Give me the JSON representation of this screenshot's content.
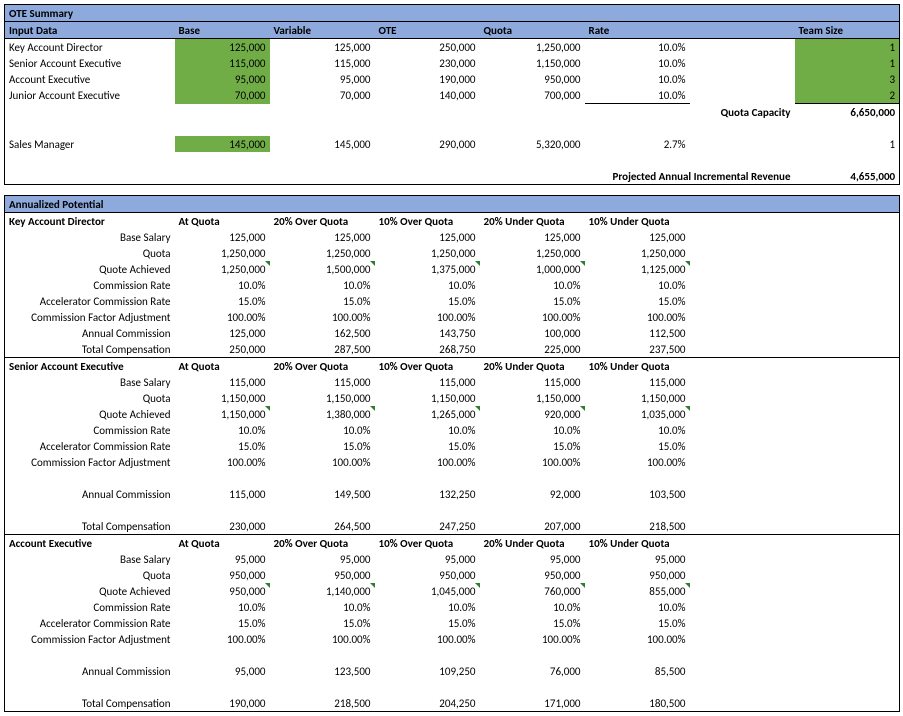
{
  "ote": {
    "title": "OTE Summary",
    "headers": {
      "input_data": "Input Data",
      "base": "Base",
      "variable": "Variable",
      "ote": "OTE",
      "quota": "Quota",
      "rate": "Rate",
      "team_size": "Team Size"
    },
    "rows": [
      {
        "role": "Key Account Director",
        "base": "125,000",
        "variable": "125,000",
        "ote": "250,000",
        "quota": "1,250,000",
        "rate": "10.0%",
        "team": "1"
      },
      {
        "role": "Senior Account Executive",
        "base": "115,000",
        "variable": "115,000",
        "ote": "230,000",
        "quota": "1,150,000",
        "rate": "10.0%",
        "team": "1"
      },
      {
        "role": "Account Executive",
        "base": "95,000",
        "variable": "95,000",
        "ote": "190,000",
        "quota": "950,000",
        "rate": "10.0%",
        "team": "3"
      },
      {
        "role": "Junior Account Executive",
        "base": "70,000",
        "variable": "70,000",
        "ote": "140,000",
        "quota": "700,000",
        "rate": "10.0%",
        "team": "2"
      }
    ],
    "quota_capacity_label": "Quota Capacity",
    "quota_capacity_value": "6,650,000",
    "manager": {
      "role": "Sales Manager",
      "base": "145,000",
      "variable": "145,000",
      "ote": "290,000",
      "quota": "5,320,000",
      "rate": "2.7%",
      "team": "1"
    },
    "projected_label": "Projected Annual Incremental Revenue",
    "projected_value": "4,655,000"
  },
  "annualized": {
    "title": "Annualized Potential",
    "scenario_labels": [
      "At Quota",
      "20% Over Quota",
      "10% Over Quota",
      "20% Under Quota",
      "10% Under Quota"
    ],
    "row_labels": {
      "base": "Base Salary",
      "quota": "Quota",
      "achieved": "Quote Achieved",
      "comm_rate": "Commission Rate",
      "accel_rate": "Accelerator Commission Rate",
      "factor": "Commission Factor Adjustment",
      "annual_comm": "Annual Commission",
      "total_comp": "Total Compensation"
    },
    "roles": [
      {
        "name": "Key Account Director",
        "base": [
          "125,000",
          "125,000",
          "125,000",
          "125,000",
          "125,000"
        ],
        "quota": [
          "1,250,000",
          "1,250,000",
          "1,250,000",
          "1,250,000",
          "1,250,000"
        ],
        "achieved": [
          "1,250,000",
          "1,500,000",
          "1,375,000",
          "1,000,000",
          "1,125,000"
        ],
        "comm_rate": [
          "10.0%",
          "10.0%",
          "10.0%",
          "10.0%",
          "10.0%"
        ],
        "accel_rate": [
          "15.0%",
          "15.0%",
          "15.0%",
          "15.0%",
          "15.0%"
        ],
        "factor": [
          "100.00%",
          "100.00%",
          "100.00%",
          "100.00%",
          "100.00%"
        ],
        "annual_comm": [
          "125,000",
          "162,500",
          "143,750",
          "100,000",
          "112,500"
        ],
        "total_comp": [
          "250,000",
          "287,500",
          "268,750",
          "225,000",
          "237,500"
        ]
      },
      {
        "name": "Senior Account Executive",
        "base": [
          "115,000",
          "115,000",
          "115,000",
          "115,000",
          "115,000"
        ],
        "quota": [
          "1,150,000",
          "1,150,000",
          "1,150,000",
          "1,150,000",
          "1,150,000"
        ],
        "achieved": [
          "1,150,000",
          "1,380,000",
          "1,265,000",
          "920,000",
          "1,035,000"
        ],
        "comm_rate": [
          "10.0%",
          "10.0%",
          "10.0%",
          "10.0%",
          "10.0%"
        ],
        "accel_rate": [
          "15.0%",
          "15.0%",
          "15.0%",
          "15.0%",
          "15.0%"
        ],
        "factor": [
          "100.00%",
          "100.00%",
          "100.00%",
          "100.00%",
          "100.00%"
        ],
        "annual_comm": [
          "115,000",
          "149,500",
          "132,250",
          "92,000",
          "103,500"
        ],
        "total_comp": [
          "230,000",
          "264,500",
          "247,250",
          "207,000",
          "218,500"
        ]
      },
      {
        "name": "Account Executive",
        "base": [
          "95,000",
          "95,000",
          "95,000",
          "95,000",
          "95,000"
        ],
        "quota": [
          "950,000",
          "950,000",
          "950,000",
          "950,000",
          "950,000"
        ],
        "achieved": [
          "950,000",
          "1,140,000",
          "1,045,000",
          "760,000",
          "855,000"
        ],
        "comm_rate": [
          "10.0%",
          "10.0%",
          "10.0%",
          "10.0%",
          "10.0%"
        ],
        "accel_rate": [
          "15.0%",
          "15.0%",
          "15.0%",
          "15.0%",
          "15.0%"
        ],
        "factor": [
          "100.00%",
          "100.00%",
          "100.00%",
          "100.00%",
          "100.00%"
        ],
        "annual_comm": [
          "95,000",
          "123,500",
          "109,250",
          "76,000",
          "85,500"
        ],
        "total_comp": [
          "190,000",
          "218,500",
          "204,250",
          "171,000",
          "180,500"
        ]
      }
    ]
  }
}
